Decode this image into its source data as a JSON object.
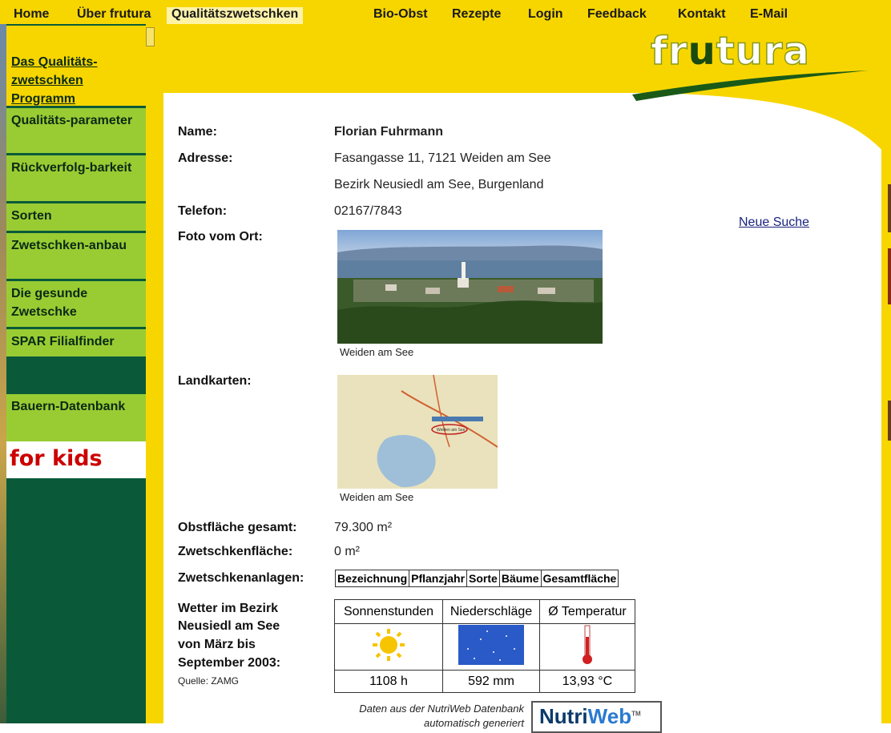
{
  "topnav": {
    "items": [
      "Home",
      "Über frutura",
      "Qualitätszwetschken",
      "Bio-Obst",
      "Rezepte",
      "Login",
      "Feedback",
      "Kontakt",
      "E-Mail"
    ]
  },
  "sidebar": {
    "items": [
      "Das Qualitäts-zwetschken Programm",
      "Qualitäts-parameter",
      "Rückverfolg-barkeit",
      "Sorten",
      "Zwetschken-anbau",
      "Die gesunde Zwetschke",
      "SPAR Filialfinder",
      "Bauern-Datenbank"
    ],
    "kids": "for kids"
  },
  "logo": {
    "text_a": "fr",
    "text_b": "u",
    "text_c": "tura"
  },
  "farmer": {
    "name_label": "Name:",
    "name": "Florian Fuhrmann",
    "address_label": "Adresse:",
    "address1": "Fasangasse 11, 7121 Weiden am See",
    "address2": "Bezirk Neusiedl am See, Burgenland",
    "phone_label": "Telefon:",
    "phone": "02167/7843",
    "new_search": "Neue Suche",
    "photo_label": "Foto vom Ort:",
    "photo_caption": "Weiden am See",
    "map_label": "Landkarten:",
    "map_caption": "Weiden am See",
    "map_place": "Weiden am See",
    "area_label": "Obstfläche gesamt:",
    "area": "79.300 m²",
    "plum_area_label": "Zwetschkenfläche:",
    "plum_area": "0 m²",
    "plantations_label": "Zwetschkenanlagen:",
    "plantation_headers": [
      "Bezeichnung",
      "Pflanzjahr",
      "Sorte",
      "Bäume",
      "Gesamtfläche"
    ]
  },
  "weather": {
    "label1": "Wetter im Bezirk",
    "label2": "Neusiedl am See",
    "label3": "von März bis",
    "label4": "September 2003:",
    "source": "Quelle: ZAMG",
    "headers": [
      "Sonnenstunden",
      "Niederschläge",
      "Ø Temperatur"
    ],
    "values": [
      "1108 h",
      "592 mm",
      "13,93 °C"
    ]
  },
  "footer": {
    "nutriweb_text1": "Daten aus der NutriWeb Datenbank",
    "nutriweb_text2": "automatisch generiert",
    "nutriweb_logo_a": "Nutri",
    "nutriweb_logo_b": "Web",
    "nutriweb_tm": "TM"
  },
  "colors": {
    "nav_yellow": "#f7d600",
    "sidebar_green": "#0a5a3a",
    "item_green": "#99cc33",
    "kids_red": "#cc0000"
  }
}
